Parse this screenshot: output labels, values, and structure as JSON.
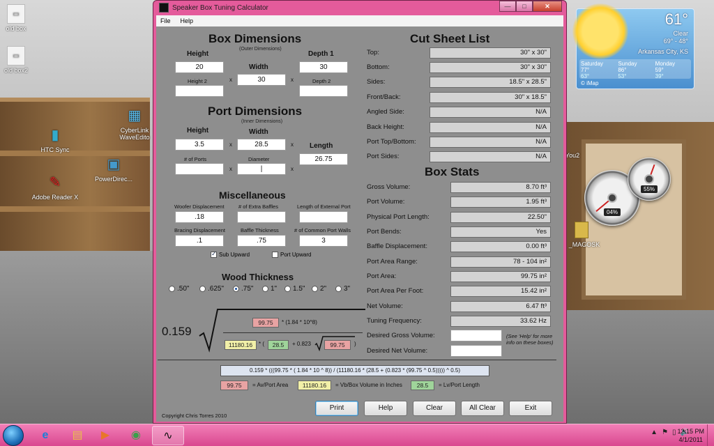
{
  "desktop": {
    "icons": [
      {
        "label": "old box",
        "glyph": "▭"
      },
      {
        "label": "old box2",
        "glyph": "▭"
      },
      {
        "label": "HTC Sync",
        "glyph": "▮"
      },
      {
        "label": "CyberLink WaveEdito",
        "glyph": "▦"
      },
      {
        "label": "PowerDirec...",
        "glyph": "▣"
      },
      {
        "label": "Adobe Reader X",
        "glyph": "✎"
      },
      {
        "label": "You2",
        "glyph": ""
      },
      {
        "label": "_MAGOSK",
        "glyph": ""
      }
    ]
  },
  "weather": {
    "temp": "61°",
    "condition": "Clear",
    "range": "69° - 48°",
    "city": "Arkansas City, KS",
    "days": [
      {
        "name": "Saturday",
        "hi": "77°",
        "lo": "63°"
      },
      {
        "name": "Sunday",
        "hi": "86°",
        "lo": "53°"
      },
      {
        "name": "Monday",
        "hi": "59°",
        "lo": "39°"
      }
    ],
    "source": "© iMap"
  },
  "gauges": {
    "cpu": "04%",
    "memory": "55%"
  },
  "window": {
    "title": "Speaker Box Tuning Calculator",
    "minimize": "—",
    "maximize": "□",
    "close": "✕"
  },
  "menu": {
    "file": "File",
    "help": "Help"
  },
  "box_dimensions": {
    "heading": "Box Dimensions",
    "subheading": "(Outer Dimensions)",
    "height_label": "Height",
    "width_label": "Width",
    "depth1_label": "Depth 1",
    "height2_label": "Height 2",
    "depth2_label": "Depth 2",
    "height": "20",
    "width": "30",
    "depth1": "30",
    "height2": "",
    "depth2": "",
    "times": "x"
  },
  "port_dimensions": {
    "heading": "Port Dimensions",
    "subheading": "(Inner Dimensions)",
    "height_label": "Height",
    "width_label": "Width",
    "length_label": "Length",
    "num_ports_label": "# of Ports",
    "diameter_label": "Diameter",
    "height": "3.5",
    "width": "28.5",
    "length": "26.75",
    "num_ports": "",
    "diameter": "|"
  },
  "misc": {
    "heading": "Miscellaneous",
    "woofer_disp_label": "Woofer Displacement",
    "extra_baffles_label": "# of Extra Baffles",
    "ext_port_label": "Length of External Port",
    "bracing_disp_label": "Bracing Displacement",
    "baffle_thick_label": "Baffle Thickness",
    "common_walls_label": "# of Common Port Walls",
    "woofer_disp": ".18",
    "extra_baffles": "",
    "ext_port": "",
    "bracing_disp": ".1",
    "baffle_thick": ".75",
    "common_walls": "3",
    "sub_upward": "Sub Upward",
    "port_upward": "Port Upward"
  },
  "wood": {
    "heading": "Wood Thickness",
    "options": [
      ".50\"",
      ".625\"",
      ".75\"",
      "1\"",
      "1.5\"",
      "2\"",
      "3\""
    ],
    "selected": 2
  },
  "formula": {
    "coef": "0.159",
    "av": "99.75",
    "num_tail": "* (1.84 * 10^8)",
    "vb": "11180.16",
    "mul_open": "* (",
    "lv": "28.5",
    "plus": "+ 0.823",
    "av2": "99.75",
    "close": ")",
    "expression": "0.159 * (((99.75 * ( 1.84 * 10 ^ 8)) / (11180.16 * (28.5 + (0.823 * (99.75 ^ 0.5))))) ^ 0.5)",
    "legend_av": "99.75",
    "legend_av_text": "= Av/Port Area",
    "legend_vb": "11180.16",
    "legend_vb_text": "= Vb/Box Volume in Inches",
    "legend_lv": "28.5",
    "legend_lv_text": "= Lv/Port Length"
  },
  "cut_sheet": {
    "heading": "Cut Sheet List",
    "rows": [
      {
        "label": "Top:",
        "value": "30\" x 30\""
      },
      {
        "label": "Bottom:",
        "value": "30\" x 30\""
      },
      {
        "label": "Sides:",
        "value": "18.5\" x 28.5\""
      },
      {
        "label": "Front/Back:",
        "value": "30\" x 18.5\""
      },
      {
        "label": "Angled Side:",
        "value": "N/A"
      },
      {
        "label": "Back Height:",
        "value": "N/A"
      },
      {
        "label": "Port Top/Bottom:",
        "value": "N/A"
      },
      {
        "label": "Port Sides:",
        "value": "N/A"
      }
    ]
  },
  "box_stats": {
    "heading": "Box Stats",
    "rows": [
      {
        "label": "Gross Volume:",
        "value": "8.70 ft³"
      },
      {
        "label": "Port Volume:",
        "value": "1.95 ft³"
      },
      {
        "label": "Physical Port Length:",
        "value": "22.50\""
      },
      {
        "label": "Port Bends:",
        "value": "Yes"
      },
      {
        "label": "Baffle Displacement:",
        "value": "0.00 ft³"
      },
      {
        "label": "Port Area Range:",
        "value": "78 - 104 in²"
      },
      {
        "label": "Port Area:",
        "value": "99.75 in²"
      },
      {
        "label": "Port Area Per Foot:",
        "value": "15.42 in²"
      },
      {
        "label": "Net Volume:",
        "value": "6.47 ft³"
      },
      {
        "label": "Tuning Frequency:",
        "value": "33.62 Hz"
      }
    ],
    "desired_gross_label": "Desired Gross Volume:",
    "desired_net_label": "Desired Net Volume:",
    "desired_gross": "",
    "desired_net": "",
    "help_note": "(See 'Help' for more info on these boxes)"
  },
  "copyright": "Copyright Chris Torres 2010",
  "buttons": {
    "print": "Print",
    "help": "Help",
    "clear": "Clear",
    "all_clear": "All Clear",
    "exit": "Exit"
  },
  "taskbar": {
    "items": [
      "e",
      "▤",
      "▶",
      "◉",
      "∿"
    ],
    "tray": [
      "▲",
      "⚑",
      "▯",
      "🔊"
    ],
    "time": "12:15 PM",
    "date": "4/1/2011"
  }
}
